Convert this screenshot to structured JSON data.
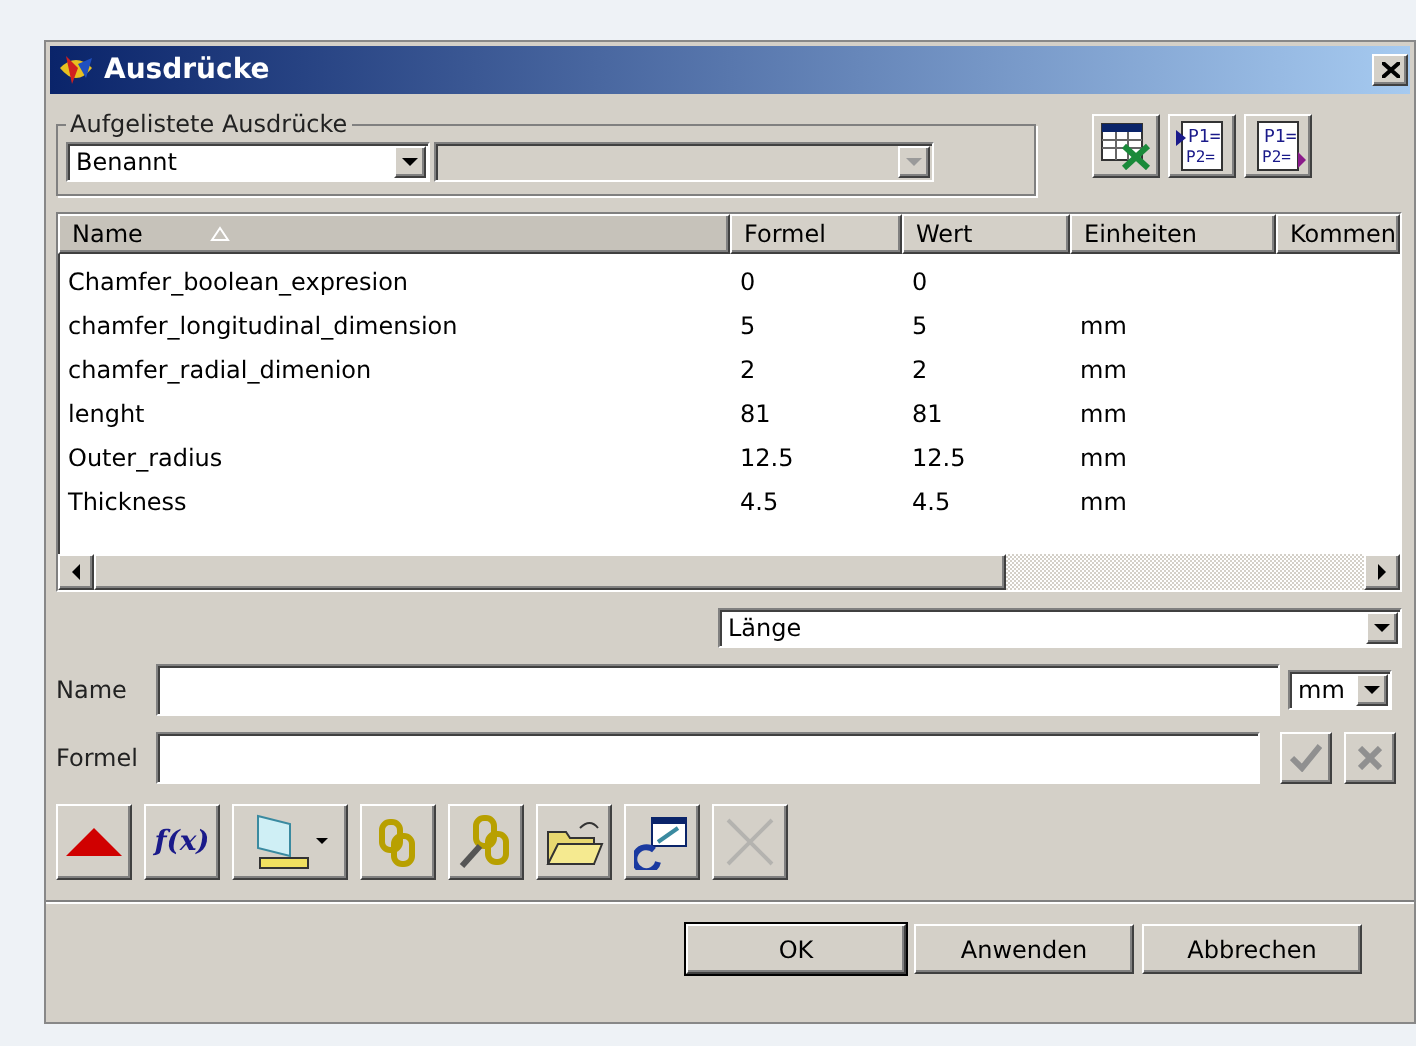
{
  "window": {
    "title": "Ausdrücke"
  },
  "listed_group": {
    "label": "Aufgelistete Ausdrücke",
    "filter": {
      "value": "Benannt"
    },
    "second_filter": {
      "disabled": true
    }
  },
  "top_buttons": [
    {
      "kind": "spreadsheet"
    },
    {
      "kind": "import",
      "lines": [
        "P1=",
        "P2="
      ]
    },
    {
      "kind": "export",
      "lines": [
        "P1=",
        "P2="
      ]
    }
  ],
  "table": {
    "columns": [
      {
        "label": "Name",
        "sorted": true
      },
      {
        "label": "Formel",
        "sorted": false
      },
      {
        "label": "Wert",
        "sorted": false
      },
      {
        "label": "Einheiten",
        "sorted": false
      },
      {
        "label": "Kommen",
        "sorted": false
      }
    ],
    "rows": [
      [
        "Chamfer_boolean_expresion",
        "0",
        "0",
        ""
      ],
      [
        "chamfer_longitudinal_dimension",
        "5",
        "5",
        "mm"
      ],
      [
        "chamfer_radial_dimenion",
        "2",
        "2",
        "mm"
      ],
      [
        "lenght",
        "81",
        "81",
        "mm"
      ],
      [
        "Outer_radius",
        "12.5",
        "12.5",
        "mm"
      ],
      [
        "Thickness",
        "4.5",
        "4.5",
        "mm"
      ]
    ]
  },
  "dimension_select": {
    "value": "Länge"
  },
  "name_field": {
    "label": "Name",
    "unit": "mm"
  },
  "formula_field": {
    "label": "Formel",
    "accept_disabled": true,
    "reject_disabled": true
  },
  "toolbar": [
    {
      "kind": "triangle",
      "disabled": false
    },
    {
      "kind": "function",
      "text": "f(x)",
      "disabled": false
    },
    {
      "kind": "measure",
      "disabled": false
    },
    {
      "kind": "link-new",
      "disabled": false
    },
    {
      "kind": "link-edit",
      "disabled": false
    },
    {
      "kind": "open",
      "disabled": false
    },
    {
      "kind": "refresh",
      "disabled": false
    },
    {
      "kind": "delete",
      "disabled": true
    }
  ],
  "buttons": [
    {
      "label": "OK",
      "default": true
    },
    {
      "label": "Anwenden",
      "default": false
    },
    {
      "label": "Abbrechen",
      "default": false
    }
  ]
}
